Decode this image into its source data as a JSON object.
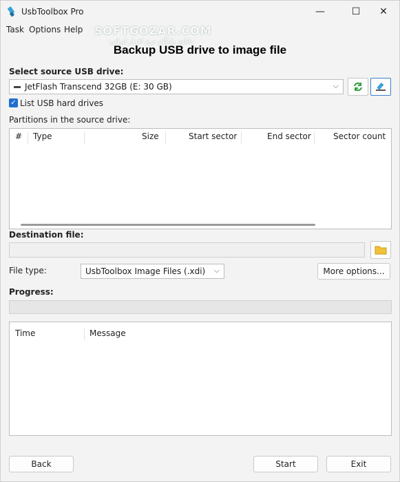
{
  "window": {
    "title": "UsbToolbox Pro",
    "minimize_glyph": "—",
    "maximize_glyph": "☐",
    "close_glyph": "✕"
  },
  "menu": {
    "items": [
      "Task",
      "Options",
      "Help"
    ]
  },
  "watermark": {
    "text": "SOFTGOZAR.COM",
    "subtext": "دانلود رایگان نرم افزار ایرانی"
  },
  "page": {
    "heading": "Backup USB drive to image file"
  },
  "source": {
    "label": "Select source USB drive:",
    "selected": "JetFlash Transcend 32GB (E:  30 GB)",
    "list_hard_drives_label": "List USB hard drives",
    "list_hard_drives_checked": true
  },
  "partitions": {
    "label": "Partitions in the source drive:",
    "columns": [
      "#",
      "Type",
      "Size",
      "Start sector",
      "End sector",
      "Sector count"
    ],
    "rows": []
  },
  "destination": {
    "label": "Destination file:",
    "value": ""
  },
  "file_type": {
    "label": "File type:",
    "selected": "UsbToolbox Image Files (.xdi)",
    "more_options_label": "More options..."
  },
  "progress": {
    "label": "Progress:",
    "percent": 0
  },
  "log": {
    "columns": [
      "Time",
      "Message"
    ],
    "rows": []
  },
  "footer": {
    "back_label": "Back",
    "start_label": "Start",
    "exit_label": "Exit"
  },
  "colors": {
    "accent": "#1f6fd0",
    "refresh_icon": "#2e9e3c",
    "folder_icon": "#f2c23a"
  }
}
